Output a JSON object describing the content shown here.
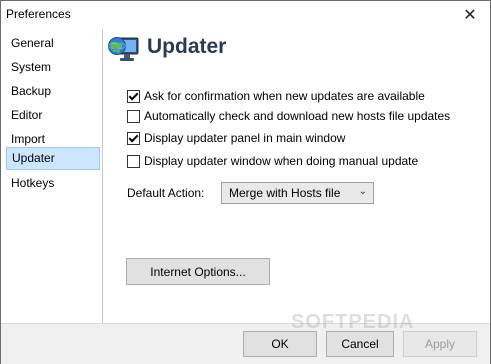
{
  "window": {
    "title": "Preferences",
    "close_glyph": "✕"
  },
  "sidebar": {
    "items": [
      {
        "label": "General",
        "selected": false
      },
      {
        "label": "System",
        "selected": false
      },
      {
        "label": "Backup",
        "selected": false
      },
      {
        "label": "Editor",
        "selected": false
      },
      {
        "label": "Import",
        "selected": false
      },
      {
        "label": "Updater",
        "selected": true
      },
      {
        "label": "Hotkeys",
        "selected": false
      }
    ]
  },
  "page": {
    "title": "Updater",
    "icon": "globe-monitor-icon"
  },
  "options": [
    {
      "label": "Ask for confirmation when new updates are available",
      "checked": true
    },
    {
      "label": "Automatically check and download new hosts file updates",
      "checked": false
    },
    {
      "label": "Display updater panel in main window",
      "checked": true
    },
    {
      "label": "Display updater window when doing manual update",
      "checked": false
    }
  ],
  "default_action": {
    "label": "Default Action:",
    "selected": "Merge with Hosts file"
  },
  "internet_options_label": "Internet Options...",
  "footer": {
    "ok": "OK",
    "cancel": "Cancel",
    "apply": "Apply"
  },
  "watermark": "SOFTPEDIA",
  "colors": {
    "selection_bg": "#cce6ff",
    "selection_border": "#99c9f4",
    "title_color": "#2b3a55"
  }
}
